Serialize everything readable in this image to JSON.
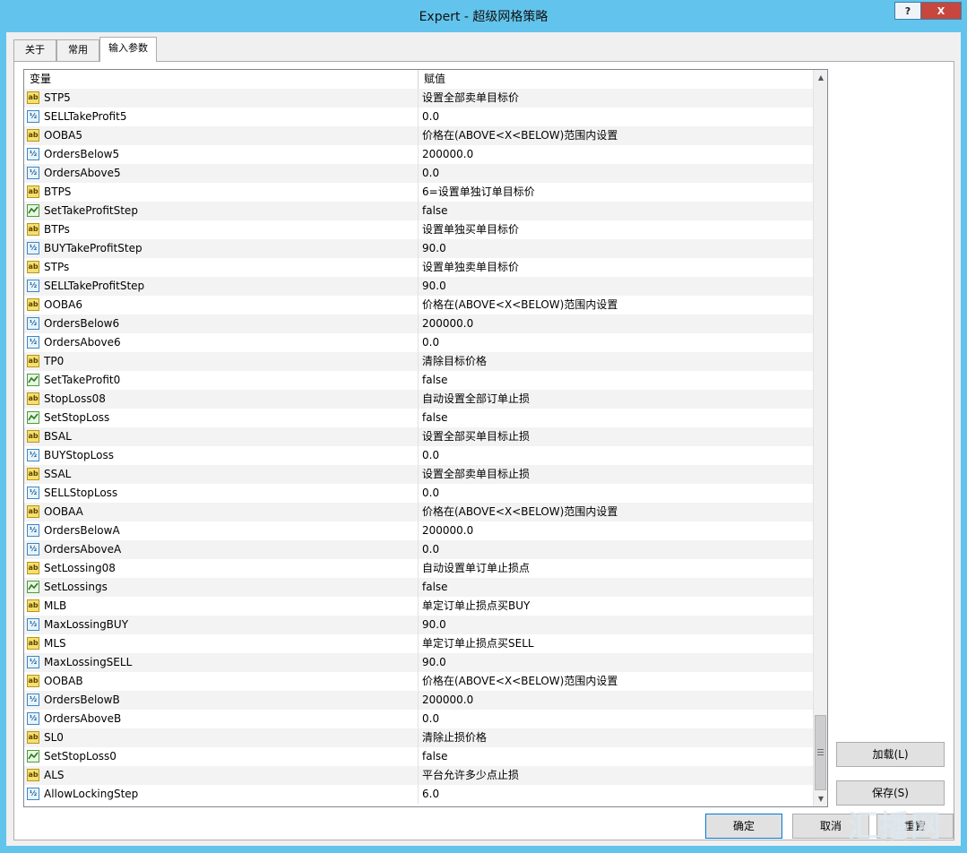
{
  "window": {
    "title": "Expert - 超级网格策略",
    "help_label": "?",
    "close_label": "X"
  },
  "tabs": {
    "about": "关于",
    "common": "常用",
    "input": "输入参数"
  },
  "grid": {
    "header_variable": "变量",
    "header_value": "赋值",
    "rows": [
      {
        "type": "ab",
        "name": "STP5",
        "value": "设置全部卖单目标价"
      },
      {
        "type": "num",
        "name": "SELLTakeProfit5",
        "value": "0.0"
      },
      {
        "type": "ab",
        "name": "OOBA5",
        "value": "价格在(ABOVE<X<BELOW)范围内设置"
      },
      {
        "type": "num",
        "name": "OrdersBelow5",
        "value": "200000.0"
      },
      {
        "type": "num",
        "name": "OrdersAbove5",
        "value": "0.0"
      },
      {
        "type": "ab",
        "name": "BTPS",
        "value": "6=设置单独订单目标价"
      },
      {
        "type": "bool",
        "name": "SetTakeProfitStep",
        "value": "false"
      },
      {
        "type": "ab",
        "name": "BTPs",
        "value": "设置单独买单目标价"
      },
      {
        "type": "num",
        "name": "BUYTakeProfitStep",
        "value": "90.0"
      },
      {
        "type": "ab",
        "name": "STPs",
        "value": "设置单独卖单目标价"
      },
      {
        "type": "num",
        "name": "SELLTakeProfitStep",
        "value": "90.0"
      },
      {
        "type": "ab",
        "name": "OOBA6",
        "value": "价格在(ABOVE<X<BELOW)范围内设置"
      },
      {
        "type": "num",
        "name": "OrdersBelow6",
        "value": "200000.0"
      },
      {
        "type": "num",
        "name": "OrdersAbove6",
        "value": "0.0"
      },
      {
        "type": "ab",
        "name": "TP0",
        "value": "清除目标价格"
      },
      {
        "type": "bool",
        "name": "SetTakeProfit0",
        "value": "false"
      },
      {
        "type": "ab",
        "name": "StopLoss08",
        "value": "自动设置全部订单止损"
      },
      {
        "type": "bool",
        "name": "SetStopLoss",
        "value": "false"
      },
      {
        "type": "ab",
        "name": "BSAL",
        "value": "设置全部买单目标止损"
      },
      {
        "type": "num",
        "name": "BUYStopLoss",
        "value": "0.0"
      },
      {
        "type": "ab",
        "name": "SSAL",
        "value": "设置全部卖单目标止损"
      },
      {
        "type": "num",
        "name": "SELLStopLoss",
        "value": "0.0"
      },
      {
        "type": "ab",
        "name": "OOBAA",
        "value": "价格在(ABOVE<X<BELOW)范围内设置"
      },
      {
        "type": "num",
        "name": "OrdersBelowA",
        "value": "200000.0"
      },
      {
        "type": "num",
        "name": "OrdersAboveA",
        "value": "0.0"
      },
      {
        "type": "ab",
        "name": "SetLossing08",
        "value": "自动设置单订单止损点"
      },
      {
        "type": "bool",
        "name": "SetLossings",
        "value": "false"
      },
      {
        "type": "ab",
        "name": "MLB",
        "value": "单定订单止损点买BUY"
      },
      {
        "type": "num",
        "name": "MaxLossingBUY",
        "value": "90.0"
      },
      {
        "type": "ab",
        "name": "MLS",
        "value": "单定订单止损点买SELL"
      },
      {
        "type": "num",
        "name": "MaxLossingSELL",
        "value": "90.0"
      },
      {
        "type": "ab",
        "name": "OOBAB",
        "value": "价格在(ABOVE<X<BELOW)范围内设置"
      },
      {
        "type": "num",
        "name": "OrdersBelowB",
        "value": "200000.0"
      },
      {
        "type": "num",
        "name": "OrdersAboveB",
        "value": "0.0"
      },
      {
        "type": "ab",
        "name": "SL0",
        "value": "清除止损价格"
      },
      {
        "type": "bool",
        "name": "SetStopLoss0",
        "value": "false"
      },
      {
        "type": "ab",
        "name": "ALS",
        "value": "平台允许多少点止损"
      },
      {
        "type": "num",
        "name": "AllowLockingStep",
        "value": "6.0"
      }
    ]
  },
  "icons": {
    "ab_label": "ab",
    "num_label": "½"
  },
  "buttons": {
    "load": "加载(L)",
    "save": "保存(S)",
    "ok": "确定",
    "cancel": "取消",
    "reset": "重置"
  },
  "watermark": "汇播网"
}
